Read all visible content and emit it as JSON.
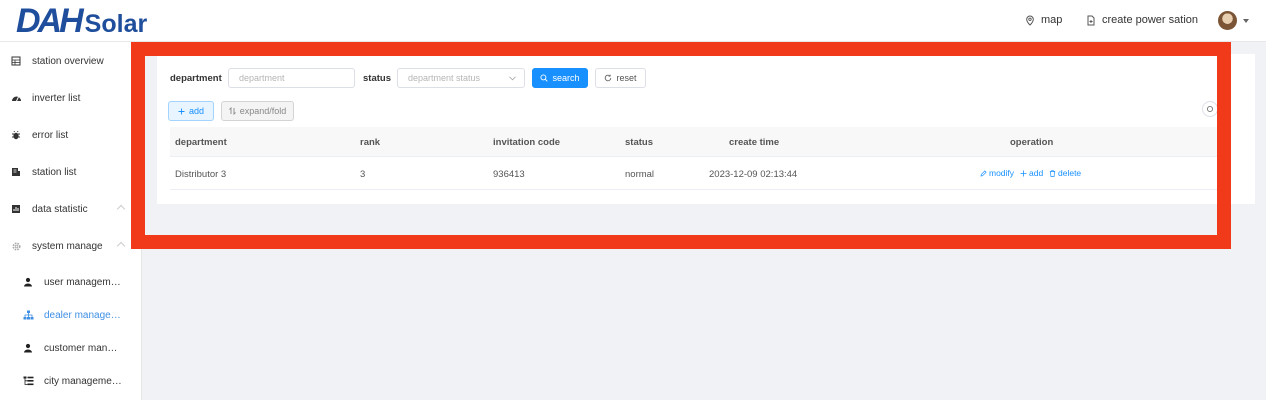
{
  "brand": {
    "logo_main": "DAH",
    "logo_suffix": "Solar",
    "color": "#1f4e9c"
  },
  "header": {
    "map_label": "map",
    "create_label": "create power sation"
  },
  "sidebar": {
    "items": [
      {
        "label": "station overview",
        "icon": "grid-icon"
      },
      {
        "label": "inverter list",
        "icon": "gauge-icon"
      },
      {
        "label": "error list",
        "icon": "bug-icon"
      },
      {
        "label": "station list",
        "icon": "station-icon"
      },
      {
        "label": "data statistic",
        "icon": "chart-icon"
      },
      {
        "label": "system manage",
        "icon": "gear-icon"
      }
    ],
    "sub_items": [
      {
        "label": "user managem…",
        "icon": "user-icon"
      },
      {
        "label": "dealer manage…",
        "icon": "org-icon",
        "active": true
      },
      {
        "label": "customer man…",
        "icon": "user-icon"
      },
      {
        "label": "city manageme…",
        "icon": "tree-icon"
      }
    ]
  },
  "filters": {
    "department_label": "department",
    "department_placeholder": "department",
    "status_label": "status",
    "status_placeholder": "department status",
    "search_label": "search",
    "reset_label": "reset"
  },
  "toolbar": {
    "add_label": "add",
    "expand_label": "expand/fold"
  },
  "table": {
    "columns": [
      "department",
      "rank",
      "invitation code",
      "status",
      "create time",
      "operation"
    ],
    "rows": [
      {
        "department": "Distributor 3",
        "rank": "3",
        "invitation_code": "936413",
        "status": "normal",
        "create_time": "2023-12-09 02:13:44"
      }
    ],
    "ops": {
      "modify": "modify",
      "add": "add",
      "delete": "delete"
    }
  },
  "colors": {
    "accent": "#1890ff",
    "highlight": "#f03a1a"
  }
}
